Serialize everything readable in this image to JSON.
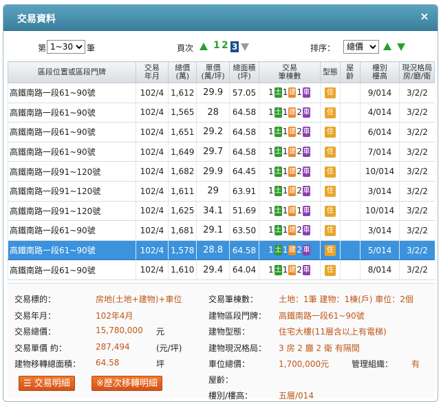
{
  "window": {
    "title": "交易資料",
    "close": "×"
  },
  "controls": {
    "page_prefix": "第",
    "page_range": "1~30",
    "page_suffix": "筆",
    "page_label": "頁次",
    "pages": [
      "1",
      "2",
      "3"
    ],
    "current_page": "3",
    "sort_label": "排序：",
    "sort_value": "總價"
  },
  "table": {
    "headers": {
      "address": "區段位置或區段門牌",
      "date": [
        "交易",
        "年月"
      ],
      "total": [
        "總價",
        "(萬)"
      ],
      "unit": [
        "單價",
        "(萬/坪)"
      ],
      "area": [
        "總面積",
        "(坪)"
      ],
      "count": [
        "交易",
        "筆棟數"
      ],
      "type": "型態",
      "age": [
        "屋",
        "齡"
      ],
      "floor": [
        "樓別",
        "樓高"
      ],
      "layout": [
        "現況格局",
        "房/廳/衛"
      ]
    },
    "chips": {
      "land": "土",
      "building": "建",
      "car": "車"
    },
    "rows": [
      {
        "address": "高鐵南路一段61~90號",
        "date": "102/4",
        "total": "1,612",
        "unit": "29.9",
        "area": "57.05",
        "land": "1",
        "building": "1",
        "car": "1",
        "type": "住",
        "age": "",
        "floor": "9/014",
        "layout": "3/2/2"
      },
      {
        "address": "高鐵南路一段61~90號",
        "date": "102/4",
        "total": "1,565",
        "unit": "28",
        "area": "64.58",
        "land": "1",
        "building": "1",
        "car": "2",
        "type": "住",
        "age": "",
        "floor": "4/014",
        "layout": "3/2/2"
      },
      {
        "address": "高鐵南路一段61~90號",
        "date": "102/4",
        "total": "1,651",
        "unit": "29.2",
        "area": "64.58",
        "land": "1",
        "building": "1",
        "car": "2",
        "type": "住",
        "age": "",
        "floor": "6/014",
        "layout": "3/2/2"
      },
      {
        "address": "高鐵南路一段61~90號",
        "date": "102/4",
        "total": "1,649",
        "unit": "29.7",
        "area": "64.58",
        "land": "1",
        "building": "1",
        "car": "2",
        "type": "住",
        "age": "",
        "floor": "7/014",
        "layout": "3/2/2"
      },
      {
        "address": "高鐵南路一段91~120號",
        "date": "102/4",
        "total": "1,682",
        "unit": "29.9",
        "area": "64.45",
        "land": "1",
        "building": "1",
        "car": "2",
        "type": "住",
        "age": "",
        "floor": "10/014",
        "layout": "3/2/2"
      },
      {
        "address": "高鐵南路一段91~120號",
        "date": "102/4",
        "total": "1,611",
        "unit": "29",
        "area": "63.91",
        "land": "1",
        "building": "1",
        "car": "2",
        "type": "住",
        "age": "",
        "floor": "3/014",
        "layout": "3/2/2"
      },
      {
        "address": "高鐵南路一段91~120號",
        "date": "102/4",
        "total": "1,625",
        "unit": "34.1",
        "area": "51.69",
        "land": "1",
        "building": "1",
        "car": "1",
        "type": "住",
        "age": "",
        "floor": "10/014",
        "layout": "3/2/2"
      },
      {
        "address": "高鐵南路一段61~90號",
        "date": "102/4",
        "total": "1,681",
        "unit": "29.1",
        "area": "63.50",
        "land": "1",
        "building": "1",
        "car": "2",
        "type": "住",
        "age": "",
        "floor": "3/014",
        "layout": "3/2/2"
      },
      {
        "address": "高鐵南路一段61~90號",
        "date": "102/4",
        "total": "1,578",
        "unit": "28.8",
        "area": "64.58",
        "land": "1",
        "building": "1",
        "car": "2",
        "type": "住",
        "age": "",
        "floor": "5/014",
        "layout": "3/2/2",
        "selected": true
      },
      {
        "address": "高鐵南路一段61~90號",
        "date": "102/4",
        "total": "1,610",
        "unit": "29.4",
        "area": "64.04",
        "land": "1",
        "building": "1",
        "car": "2",
        "type": "住",
        "age": "",
        "floor": "8/014",
        "layout": "3/2/2"
      }
    ]
  },
  "detail": {
    "left": [
      {
        "label": "交易標的：",
        "value": "房地(土地+建物)+車位",
        "unit": ""
      },
      {
        "label": "交易年月：",
        "value": "102年4月",
        "unit": ""
      },
      {
        "label": "交易總價：",
        "value": "15,780,000",
        "unit": "元"
      },
      {
        "label": "交易單價 約：",
        "value": "287,494",
        "unit": "(元/坪)"
      },
      {
        "label": "建物移轉總面積：",
        "value": "64.58",
        "unit": "坪"
      }
    ],
    "right": [
      {
        "label": "交易筆棟數：",
        "value": "土地：1筆 建物：1棟(戶) 車位：2個"
      },
      {
        "label": "建物區段門牌：",
        "value": "高鐵南路一段61~90號"
      },
      {
        "label": "建物型態：",
        "value": "住宅大樓(11層含以上有電梯)"
      },
      {
        "label": "建物現況格局：",
        "value": "3 房 2 廳 2 衛 有隔間"
      },
      {
        "label": "車位總價：",
        "value": "1,700,000元"
      },
      {
        "label": "屋齡：",
        "value": ""
      },
      {
        "label": "樓別/樓高：",
        "value": "五層/014"
      }
    ],
    "management_label": "管理組織：",
    "management_value": "有",
    "buttons": {
      "detail": "交易明細",
      "history": "※歷次移轉明細"
    }
  }
}
